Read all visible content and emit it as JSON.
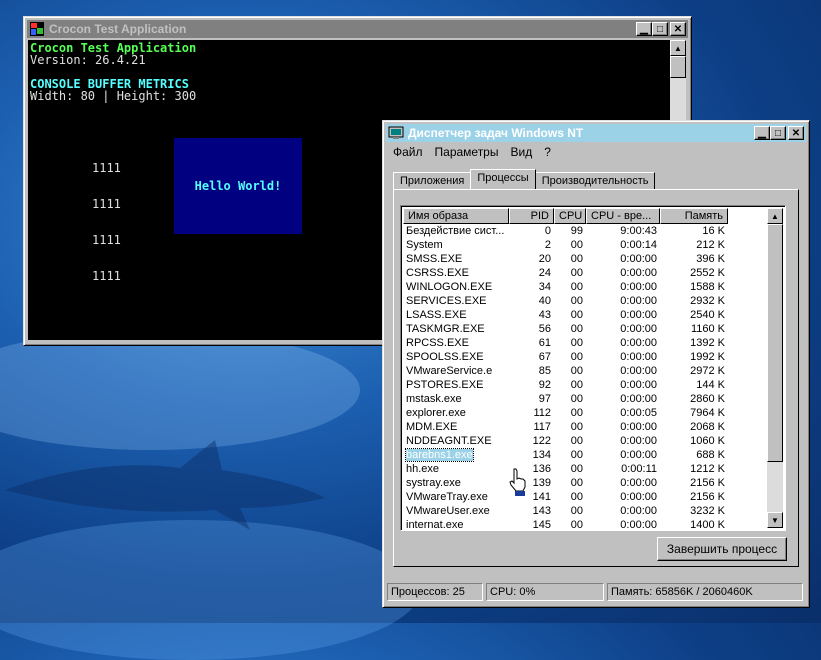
{
  "console_window": {
    "title": "Crocon Test Application",
    "lines": [
      {
        "text": "Crocon Test Application",
        "style": "green"
      },
      {
        "text": "Version: 26.4.21",
        "style": "white"
      },
      {
        "text": "",
        "style": "white"
      },
      {
        "text": "CONSOLE BUFFER METRICS",
        "style": "cyan"
      },
      {
        "text": "Width: 80 | Height: 300",
        "style": "white"
      }
    ],
    "numbers": [
      "1111",
      "1111",
      "1111",
      "1111"
    ],
    "hello_box_text": "Hello World!"
  },
  "taskmgr": {
    "title": "Диспетчер задач Windows NT",
    "menu": [
      "Файл",
      "Параметры",
      "Вид",
      "?"
    ],
    "tabs": [
      {
        "label": "Приложения",
        "selected": false
      },
      {
        "label": "Процессы",
        "selected": true
      },
      {
        "label": "Производительность",
        "selected": false
      }
    ],
    "columns": [
      "Имя образа",
      "PID",
      "CPU",
      "CPU - вре...",
      "Память"
    ],
    "processes": [
      {
        "name": "Бездействие сист...",
        "pid": "0",
        "cpu": "99",
        "time": "9:00:43",
        "mem": "16 K"
      },
      {
        "name": "System",
        "pid": "2",
        "cpu": "00",
        "time": "0:00:14",
        "mem": "212 K"
      },
      {
        "name": "SMSS.EXE",
        "pid": "20",
        "cpu": "00",
        "time": "0:00:00",
        "mem": "396 K"
      },
      {
        "name": "CSRSS.EXE",
        "pid": "24",
        "cpu": "00",
        "time": "0:00:00",
        "mem": "2552 K"
      },
      {
        "name": "WINLOGON.EXE",
        "pid": "34",
        "cpu": "00",
        "time": "0:00:00",
        "mem": "1588 K"
      },
      {
        "name": "SERVICES.EXE",
        "pid": "40",
        "cpu": "00",
        "time": "0:00:00",
        "mem": "2932 K"
      },
      {
        "name": "LSASS.EXE",
        "pid": "43",
        "cpu": "00",
        "time": "0:00:00",
        "mem": "2540 K"
      },
      {
        "name": "TASKMGR.EXE",
        "pid": "56",
        "cpu": "00",
        "time": "0:00:00",
        "mem": "1160 K"
      },
      {
        "name": "RPCSS.EXE",
        "pid": "61",
        "cpu": "00",
        "time": "0:00:00",
        "mem": "1392 K"
      },
      {
        "name": "SPOOLSS.EXE",
        "pid": "67",
        "cpu": "00",
        "time": "0:00:00",
        "mem": "1992 K"
      },
      {
        "name": "VMwareService.e",
        "pid": "85",
        "cpu": "00",
        "time": "0:00:00",
        "mem": "2972 K"
      },
      {
        "name": "PSTORES.EXE",
        "pid": "92",
        "cpu": "00",
        "time": "0:00:00",
        "mem": "144 K"
      },
      {
        "name": "mstask.exe",
        "pid": "97",
        "cpu": "00",
        "time": "0:00:00",
        "mem": "2860 K"
      },
      {
        "name": "explorer.exe",
        "pid": "112",
        "cpu": "00",
        "time": "0:00:05",
        "mem": "7964 K"
      },
      {
        "name": "MDM.EXE",
        "pid": "117",
        "cpu": "00",
        "time": "0:00:00",
        "mem": "2068 K"
      },
      {
        "name": "NDDEAGNT.EXE",
        "pid": "122",
        "cpu": "00",
        "time": "0:00:00",
        "mem": "1060 K"
      },
      {
        "name": "barebns1.exe",
        "pid": "134",
        "cpu": "00",
        "time": "0:00:00",
        "mem": "688 K",
        "selected": true
      },
      {
        "name": "hh.exe",
        "pid": "136",
        "cpu": "00",
        "time": "0:00:11",
        "mem": "1212 K"
      },
      {
        "name": "systray.exe",
        "pid": "139",
        "cpu": "00",
        "time": "0:00:00",
        "mem": "2156 K"
      },
      {
        "name": "VMwareTray.exe",
        "pid": "141",
        "cpu": "00",
        "time": "0:00:00",
        "mem": "2156 K"
      },
      {
        "name": "VMwareUser.exe",
        "pid": "143",
        "cpu": "00",
        "time": "0:00:00",
        "mem": "3232 K"
      },
      {
        "name": "internat.exe",
        "pid": "145",
        "cpu": "00",
        "time": "0:00:00",
        "mem": "1400 K"
      }
    ],
    "end_process_label": "Завершить процесс",
    "status": {
      "processes": "Процессов: 25",
      "cpu": "CPU: 0%",
      "memory": "Память: 65856K / 2060460K"
    }
  },
  "colors": {
    "active_title": "#9bd2e8",
    "inactive_title": "#808080",
    "console_green": "#55ff55",
    "console_cyan": "#55ffff",
    "hello_bg": "#000080"
  },
  "icons": [
    "console-app-icon",
    "taskmgr-app-icon",
    "minimize-icon",
    "maximize-icon",
    "close-icon",
    "hand-cursor-icon"
  ]
}
